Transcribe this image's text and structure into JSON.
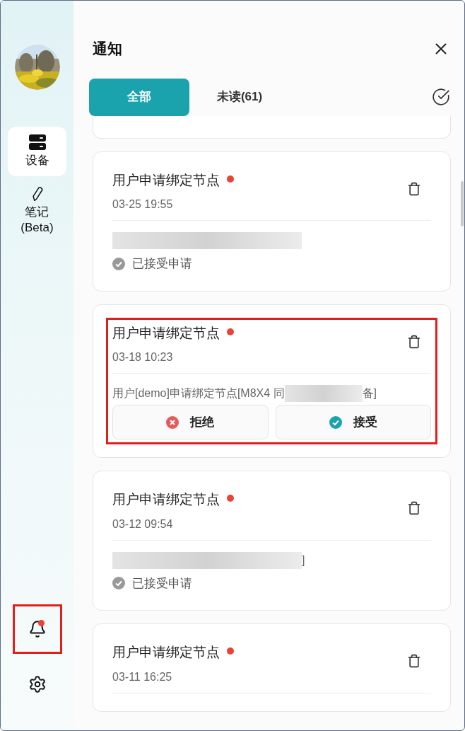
{
  "sidebar": {
    "nav_items": [
      {
        "kind": "devices",
        "lines": [
          "设备"
        ],
        "selected": true
      },
      {
        "kind": "notes",
        "lines": [
          "笔记",
          "(Beta)"
        ],
        "selected": false
      }
    ],
    "bottom_items": [
      {
        "kind": "bell",
        "badge": true,
        "highlighted": true
      },
      {
        "kind": "settings",
        "badge": false,
        "highlighted": false
      }
    ]
  },
  "header": {
    "title": "通知"
  },
  "tabs": [
    {
      "label": "全部",
      "selected": true
    },
    {
      "label": "未读(61)",
      "selected": false
    }
  ],
  "notifications": [
    {
      "title": "用户申请绑定节点",
      "unread": true,
      "time": "03-25 19:55",
      "highlighted": false,
      "message": [
        {
          "kind": "redacted"
        }
      ],
      "kind": "accepted",
      "status": "已接受申请"
    },
    {
      "title": "用户申请绑定节点",
      "unread": true,
      "time": "03-18 10:23",
      "highlighted": true,
      "message": [
        {
          "kind": "text",
          "text": "用户[demo]申请绑定节点[M8X4 同"
        },
        {
          "kind": "redacted"
        },
        {
          "kind": "text",
          "text": "备]"
        }
      ],
      "kind": "pending",
      "actions": [
        {
          "kind": "reject",
          "label": "拒绝"
        },
        {
          "kind": "accept",
          "label": "接受"
        }
      ]
    },
    {
      "title": "用户申请绑定节点",
      "unread": true,
      "time": "03-12 09:54",
      "highlighted": false,
      "message": [
        {
          "kind": "redacted"
        },
        {
          "kind": "text",
          "text": "]"
        }
      ],
      "kind": "accepted",
      "status": "已接受申请"
    },
    {
      "title": "用户申请绑定节点",
      "unread": true,
      "time": "03-11 16:25",
      "highlighted": false,
      "kind": "clipped"
    }
  ]
}
